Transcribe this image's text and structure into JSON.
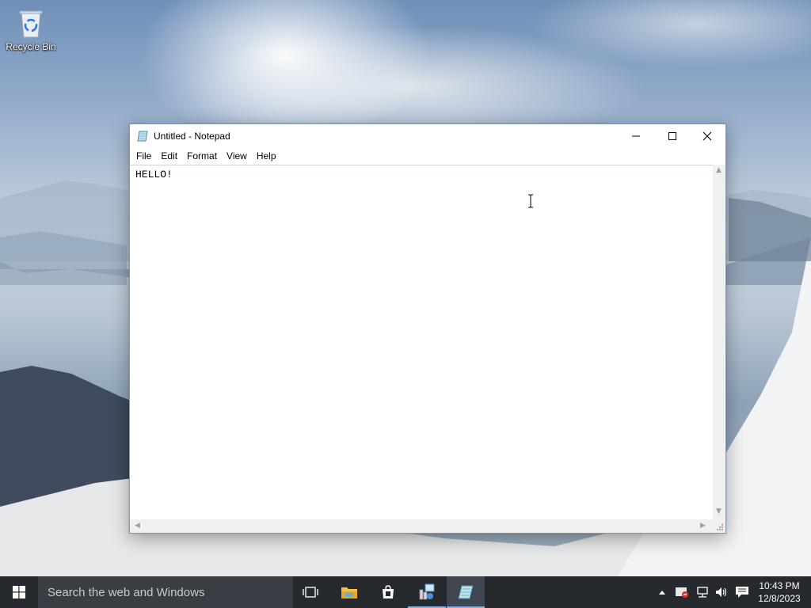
{
  "desktop": {
    "icons": [
      {
        "label": "Recycle Bin",
        "icon": "recycle-bin-icon"
      }
    ]
  },
  "window": {
    "title": "Untitled - Notepad",
    "app_icon": "notepad-icon",
    "controls": {
      "minimize": "minimize-icon",
      "maximize": "maximize-icon",
      "close": "close-icon"
    },
    "menu": [
      {
        "label": "File"
      },
      {
        "label": "Edit"
      },
      {
        "label": "Format"
      },
      {
        "label": "View"
      },
      {
        "label": "Help"
      }
    ],
    "editor": {
      "content": "HELLO!"
    }
  },
  "taskbar": {
    "search_placeholder": "Search the web and Windows",
    "apps": [
      {
        "name": "task-view-icon"
      },
      {
        "name": "file-explorer-icon"
      },
      {
        "name": "store-icon"
      },
      {
        "name": "network-app-icon"
      },
      {
        "name": "notepad-icon",
        "active": true
      }
    ],
    "tray": [
      "chevron-up-icon",
      "security-icon",
      "network-icon",
      "volume-icon",
      "action-center-icon"
    ],
    "clock": {
      "time": "10:43 PM",
      "date": "12/8/2023"
    }
  },
  "colors": {
    "taskbar": "#262a2f",
    "search_box": "#3a3e44",
    "accent": "#7fb2e6",
    "close_hover": "#e81123"
  }
}
